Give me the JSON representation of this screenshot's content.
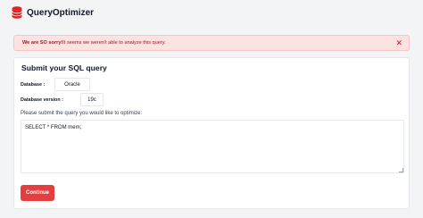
{
  "app": {
    "brand": "QueryOptimizer"
  },
  "alert": {
    "strong": "We are SO sorry!",
    "message": " It seems we weren't able to analyze this query.",
    "close": "✕"
  },
  "form": {
    "title": "Submit your SQL query",
    "database_label": "Database :",
    "database_value": "Oracle",
    "version_label": "Database version :",
    "version_value": "19c",
    "instruction": "Please submit the query you would like to optimize:",
    "query": "SELECT * FROM mem;",
    "submit_label": "Continue"
  },
  "colors": {
    "primary": "#e53e3e",
    "alert_bg": "#fde2e2",
    "alert_text": "#991b1b"
  },
  "icons": {
    "logo": "database-icon",
    "close": "close-icon"
  }
}
